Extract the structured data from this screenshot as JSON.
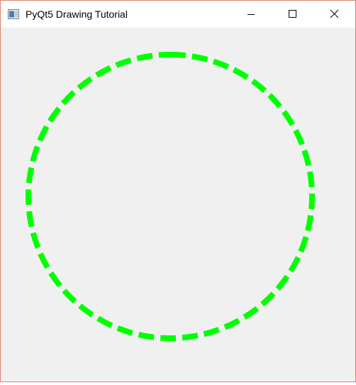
{
  "window": {
    "title": "PyQt5 Drawing Tutorial",
    "border_color": "#e0806a",
    "background_color": "#f0f0f0"
  },
  "titlebar": {
    "icon": "app-window-icon",
    "controls": {
      "minimize_icon": "minimize-icon",
      "maximize_icon": "maximize-icon",
      "close_icon": "close-icon"
    }
  },
  "drawing": {
    "shape": "circle",
    "stroke_color": "#00ff00",
    "stroke_style": "dashed"
  }
}
